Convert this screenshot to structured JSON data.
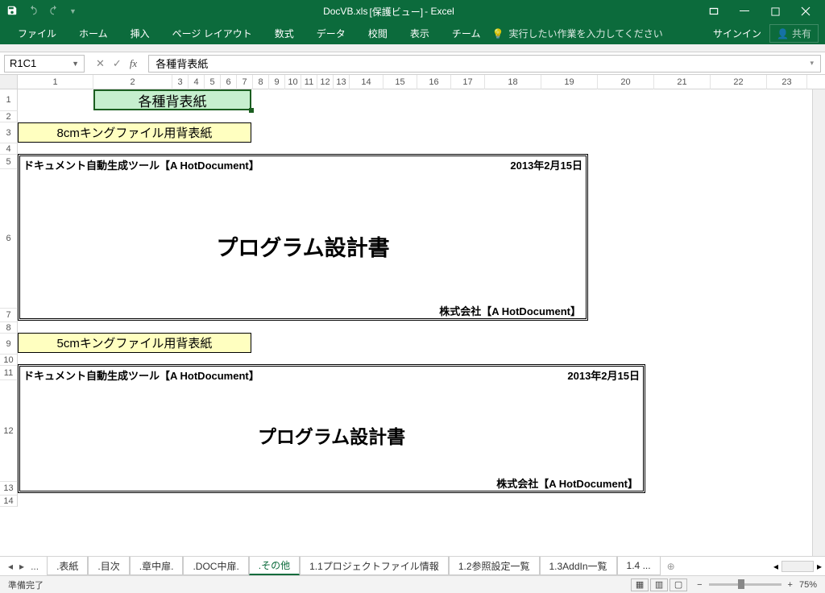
{
  "title": {
    "file": "DocVB.xls",
    "mode": "[保護ビュー]",
    "app": "- Excel"
  },
  "ribbon": {
    "file": "ファイル",
    "home": "ホーム",
    "insert": "挿入",
    "layout": "ページ レイアウト",
    "formula": "数式",
    "data": "データ",
    "review": "校閲",
    "view": "表示",
    "team": "チーム",
    "tellme": "実行したい作業を入力してください",
    "signin": "サインイン",
    "share": "共有"
  },
  "namebox": "R1C1",
  "formula_value": "各種背表紙",
  "cells": {
    "title_cell": "各種背表紙",
    "sub8": "8cmキングファイル用背表紙",
    "sub5": "5cmキングファイル用背表紙",
    "doc_tool": "ドキュメント自動生成ツール【A HotDocument】",
    "date": "2013年2月15日",
    "big_title": "プログラム設計書",
    "company": "株式会社【A HotDocument】"
  },
  "col_labels": [
    "1",
    "2",
    "3",
    "4",
    "5",
    "6",
    "7",
    "8",
    "9",
    "10",
    "11",
    "12",
    "13",
    "14",
    "15",
    "16",
    "17",
    "18",
    "19",
    "20",
    "21",
    "22",
    "23"
  ],
  "row_labels": [
    "1",
    "2",
    "3",
    "4",
    "5",
    "6",
    "7",
    "8",
    "9",
    "10",
    "11",
    "12",
    "13",
    "14"
  ],
  "sheets": {
    "items": [
      ".表紙",
      ".目次",
      ".章中扉.",
      ".DOC中扉.",
      ".その他",
      "1.1プロジェクトファイル情報",
      "1.2参照設定一覧",
      "1.3AddIn一覧",
      "1.4 ..."
    ],
    "active": 4,
    "ellipsis": "..."
  },
  "status": {
    "ready": "準備完了",
    "zoom": "75%"
  }
}
